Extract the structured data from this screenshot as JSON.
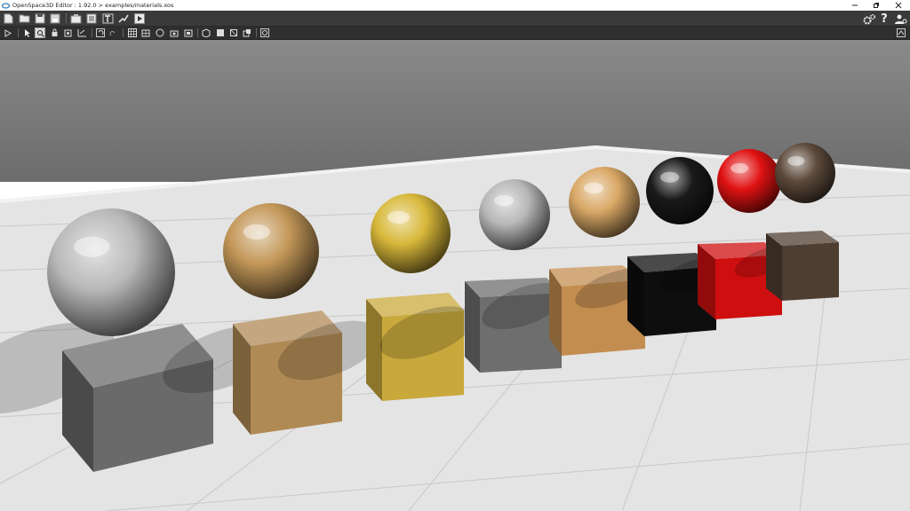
{
  "window": {
    "title": "OpenSpace3D Editor : 1.92.0 > examples/materials.xos"
  },
  "toolbar_main": {
    "left_icons": [
      "new-file-icon",
      "open-folder-icon",
      "save-icon",
      "save-as-icon",
      "import-icon",
      "calculator-icon",
      "text-tool-icon",
      "plugin-tool-icon",
      "play-icon"
    ],
    "right_icons": [
      "settings-gears-icon",
      "help-icon",
      "user-settings-icon"
    ]
  },
  "toolbar_view": {
    "icons": [
      "collapse-arrow-icon",
      "select-pointer-icon",
      "zoom-select-icon",
      "lock-icon",
      "rotate-icon",
      "scale-icon",
      "undo-icon",
      "redo-icon",
      "grid-icon",
      "grid-small-icon",
      "sphere-icon",
      "camera-icon",
      "light-icon",
      "cube-icon",
      "box-icon",
      "box-wire-icon",
      "snap-icon",
      "physics-icon",
      "viewport-options-icon"
    ]
  },
  "scene": {
    "colors": {
      "sky_top": "#8a8a8a",
      "sky_bottom": "#6c6c6c",
      "floor": "#e4e4e4",
      "grid_line": "#c8c8c8"
    },
    "objects": [
      {
        "material": "silver-rough",
        "sphere": "#b9b9b9",
        "cube": "#6a6a6a"
      },
      {
        "material": "copper",
        "sphere": "#c39758",
        "cube": "#b08a55"
      },
      {
        "material": "gold",
        "sphere": "#d8b83a",
        "cube": "#c9a93c"
      },
      {
        "material": "chrome",
        "sphere": "#b8b8b8",
        "cube": "#6e6e6e"
      },
      {
        "material": "wood",
        "sphere": "#d9a866",
        "cube": "#c38d50"
      },
      {
        "material": "black-plastic",
        "sphere": "#1a1a1a",
        "cube": "#0e0e0e"
      },
      {
        "material": "red-plastic",
        "sphere": "#e01212",
        "cube": "#cf0f0f"
      },
      {
        "material": "dark-wood",
        "sphere": "#5d4a3b",
        "cube": "#4e3e31"
      }
    ]
  }
}
